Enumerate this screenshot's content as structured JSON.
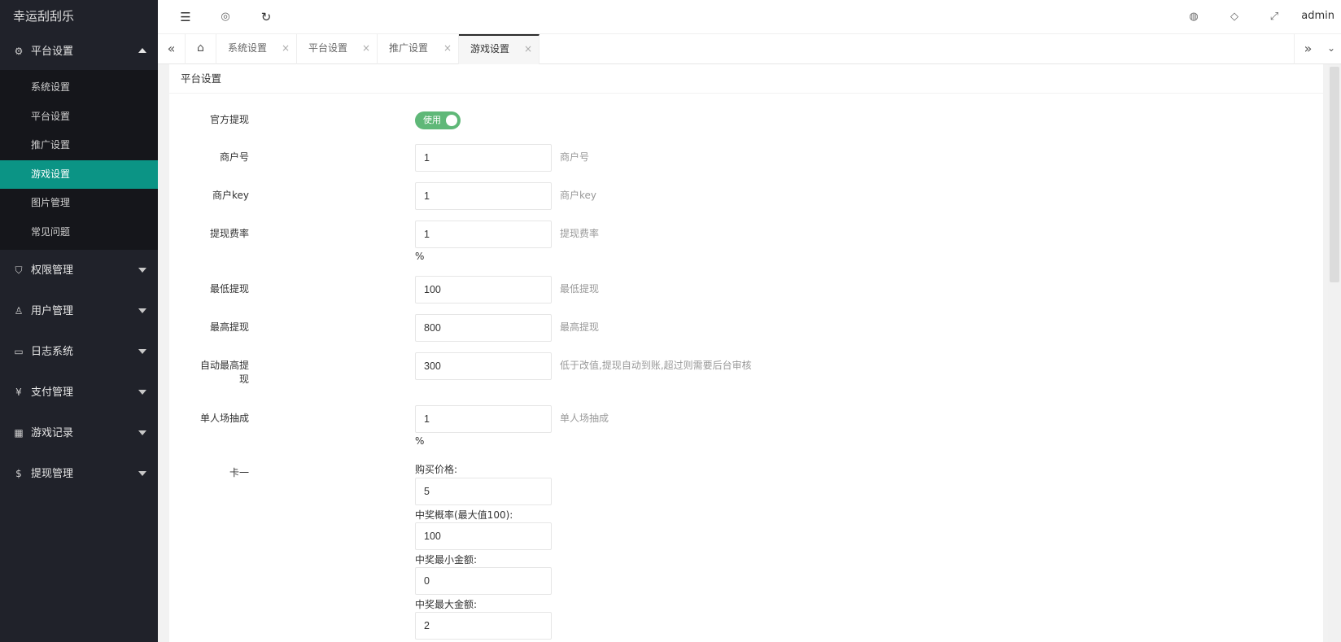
{
  "app": {
    "title": "幸运刮刮乐"
  },
  "sidebar": {
    "groups": [
      {
        "label": "平台设置",
        "icon": "gear-icon",
        "glyph": "⚙",
        "expanded": true
      },
      {
        "label": "权限管理",
        "icon": "shield-icon",
        "glyph": "⛉"
      },
      {
        "label": "用户管理",
        "icon": "user-icon",
        "glyph": "♙"
      },
      {
        "label": "日志系统",
        "icon": "book-icon",
        "glyph": "▭"
      },
      {
        "label": "支付管理",
        "icon": "yen-icon",
        "glyph": "¥"
      },
      {
        "label": "游戏记录",
        "icon": "apps-icon",
        "glyph": "▦"
      },
      {
        "label": "提现管理",
        "icon": "dollar-icon",
        "glyph": "$"
      }
    ],
    "submenu": [
      "系统设置",
      "平台设置",
      "推广设置",
      "游戏设置",
      "图片管理",
      "常见问题"
    ],
    "active_submenu": "游戏设置"
  },
  "header": {
    "icons": [
      "menu-fold-icon",
      "globe-icon",
      "refresh-icon",
      "theme-palette-icon",
      "tag-icon",
      "fullscreen-icon"
    ],
    "user": "admin"
  },
  "tabs": {
    "items": [
      "系统设置",
      "平台设置",
      "推广设置",
      "游戏设置"
    ],
    "active": "游戏设置",
    "close_glyph": "×"
  },
  "panel": {
    "title": "平台设置"
  },
  "form": {
    "official_withdraw": {
      "label": "官方提现",
      "toggle_text": "使用",
      "enabled": true
    },
    "merchant_id": {
      "label": "商户号",
      "value": "1",
      "hint": "商户号"
    },
    "merchant_key": {
      "label": "商户key",
      "value": "1",
      "hint": "商户key"
    },
    "withdraw_fee": {
      "label": "提现费率",
      "value": "1",
      "hint": "提现费率",
      "unit": "%"
    },
    "min_withdraw": {
      "label": "最低提现",
      "value": "100",
      "hint": "最低提现"
    },
    "max_withdraw": {
      "label": "最高提现",
      "value": "800",
      "hint": "最高提现"
    },
    "auto_max_withdraw": {
      "label_line1": "自动最高提",
      "label_line2": "现",
      "value": "300",
      "hint": "低于改值,提现自动到账,超过则需要后台审核"
    },
    "single_commission": {
      "label": "单人场抽成",
      "value": "1",
      "hint": "单人场抽成",
      "unit": "%"
    },
    "card1": {
      "label": "卡一",
      "buy_price_label": "购买价格:",
      "buy_price": "5",
      "win_rate_label": "中奖概率(最大值100):",
      "win_rate": "100",
      "min_prize_label": "中奖最小金额:",
      "min_prize": "0",
      "max_prize_label": "中奖最大金额:",
      "max_prize": "2"
    }
  }
}
